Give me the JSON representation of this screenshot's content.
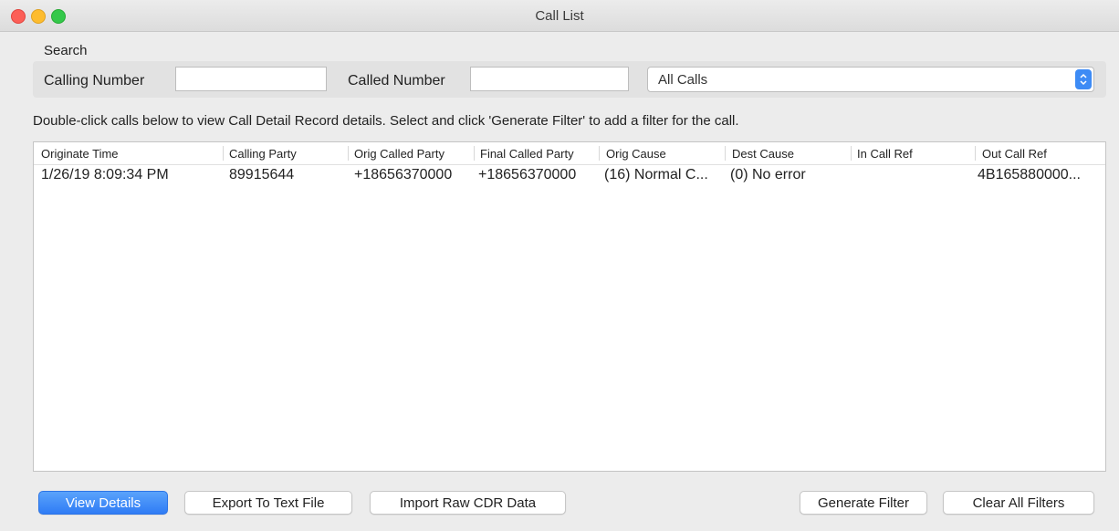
{
  "window": {
    "title": "Call List"
  },
  "search": {
    "section_label": "Search",
    "calling_number_label": "Calling Number",
    "calling_number_value": "",
    "called_number_label": "Called Number",
    "called_number_value": "",
    "filter_selected": "All Calls"
  },
  "hint": "Double-click calls below to view Call Detail Record details. Select and click 'Generate Filter' to add a filter for the call.",
  "table": {
    "columns": [
      "Originate Time",
      "Calling Party",
      "Orig Called Party",
      "Final Called Party",
      "Orig Cause",
      "Dest Cause",
      "In Call Ref",
      "Out Call Ref"
    ],
    "rows": [
      [
        "1/26/19 8:09:34 PM",
        "89915644",
        "+18656370000",
        "+18656370000",
        "(16) Normal C...",
        "(0) No error",
        "",
        "4B165880000..."
      ]
    ]
  },
  "buttons": {
    "view_details": "View Details",
    "export_text": "Export To Text File",
    "import_cdr": "Import Raw CDR Data",
    "generate_filter": "Generate Filter",
    "clear_filters": "Clear All Filters"
  },
  "colors": {
    "accent": "#3d8bf5",
    "close": "#fc5f57",
    "minimize": "#fdbc2e",
    "maximize": "#34c84a"
  }
}
